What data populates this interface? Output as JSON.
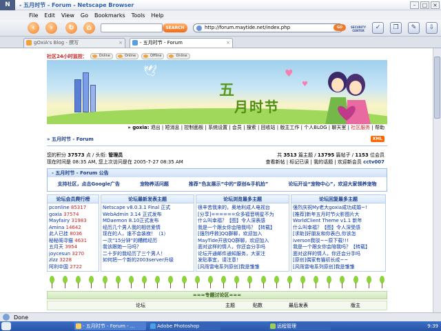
{
  "browser": {
    "logo": "N",
    "title": "- 五月时节 - Forum - Netscape Browser",
    "menu": [
      "File",
      "Edit",
      "View",
      "Go",
      "Bookmarks",
      "Tools",
      "Help"
    ],
    "search_button": "SEARCH",
    "url": "http://forum.maytide.net/index.php",
    "go_label": "GO",
    "security_center": "SECURITY CENTER",
    "tabs": [
      {
        "label": "gOxiA's Blog - 撰写"
      },
      {
        "label": "- 五月时节 - Forum"
      }
    ],
    "status": "Done"
  },
  "page": {
    "online_label": "社区24小时监控：",
    "online_badges": [
      "Online",
      "Online",
      "Offline",
      "Online"
    ],
    "banner_title": "五",
    "banner_subtitle": "月时节",
    "usernav": {
      "user": "» goxia:",
      "links": "退出 | 短消息 | 控制面板 | 系统设置 | 会员 | 搜索 | 回收站 | 版主工作 | 个人BLOG | 聊天室 |",
      "highlight": "社区服务",
      "tail": "| 帮助"
    },
    "breadcrumb": "» 五月时节 - Forum",
    "xml_badge": "XML",
    "userinfo": {
      "line1_pre": "您的积分",
      "points": "37573",
      "line1_mid": "点 / 头衔:",
      "rank": "管理员",
      "line2": "现在时间是 08:35 AM, 您上次访问是在 2005-7-27 08:35 AM"
    },
    "stats": {
      "line1_pre": "共",
      "topics": "3513",
      "line1_a": "篇主题 /",
      "posts": "13795",
      "line1_b": "篇帖子 /",
      "members": "1153",
      "line1_c": "位会员",
      "line2_pre": "查看新帖 | 标记已读 | 我的话题 | 欢迎新会员",
      "newest": "cctv007"
    },
    "announce": {
      "title": "- 五月时节 - Forum 公告",
      "items": [
        "支持社区，点击Google广告",
        "宠物养活问题",
        "推荐“色友展示”中的“原创&手机拍”",
        "论坛开设“宠物中心”，欢迎大家领养宠物"
      ]
    },
    "columns": [
      {
        "header": "论坛会员爬行榜",
        "rows": [
          {
            "name": "pconline",
            "value": "85317"
          },
          {
            "name": "goxia",
            "value": "37574"
          },
          {
            "name": "Mayfairy",
            "value": "31983"
          },
          {
            "name": "Amina",
            "value": "14642"
          },
          {
            "name": "此人已挂",
            "value": "8036"
          },
          {
            "name": "秘秘阁寻猫",
            "value": "4631"
          },
          {
            "name": "五月天",
            "value": "3954"
          },
          {
            "name": "joycesun",
            "value": "3270"
          },
          {
            "name": "zlzz",
            "value": "3228"
          },
          {
            "name": "阿利中国",
            "value": "2722"
          }
        ]
      },
      {
        "header": "论坛最新发表主题",
        "rows": [
          "Netscape v8.0.3.1 Final 正式",
          "WebAdmin 3.14 正式发布",
          "MDaemon 8.10正式发布",
          "经历几个男人我的相信爱情",
          "现在的人，谁不会装寂！（1）",
          "一次“15分钟”的糟糕经历",
          "我该跟她一马吗？",
          "二十岁的我经历了三个男人！",
          "如何把一个新的2003server升级"
        ]
      },
      {
        "header": "论坛浏览最多主题",
        "rows": [
          "很辛苦我来的，奥地利成人电视台",
          "[分享]======众多福音明星不为",
          "什么叫幸福？【图】令人深表感",
          "我是一个跟女你会陪我吗？【转载】",
          "[强烈呼救]QQ群聊，欢迎加入",
          "MayTide开放QQ群聊，欢迎加入",
          "面对这样的情人，你还会分手吗",
          "论坛开通邮件通知服务，大家注",
          "发贴事宜，请注意！",
          "[风雨雷电系列原创]我是雏雏"
        ]
      },
      {
        "header": "论坛回复最多主题",
        "rows": [
          "强烈庆祝My老大goxia成功成婚~!",
          "[推荐]新年五月时节火影图片大",
          "WorldClient Theme v1.1 新年",
          "什么叫幸福？【图】令人深受感",
          "[求助]好朋友和你表白,你该怎",
          "iverson我驳~~原下载!!!",
          "我是一个跟女你会陪我吗？【转载】",
          "面对这样的情人，你还会分手吗",
          "[原创]偶家有猫初长成~~",
          "[风雨雷电系列原创]我是雏雏"
        ]
      }
    ],
    "forum_head": "≈≈≈专题讨论区≈≈≈",
    "forum_cols": [
      "论坛",
      "主题",
      "贴数",
      "最后发表",
      "版主"
    ]
  },
  "taskbar": {
    "tasks": [
      "- 五月时节 - Forum - ...",
      "Adobe Photoshop",
      "远程管理"
    ],
    "clock": "9:39"
  }
}
